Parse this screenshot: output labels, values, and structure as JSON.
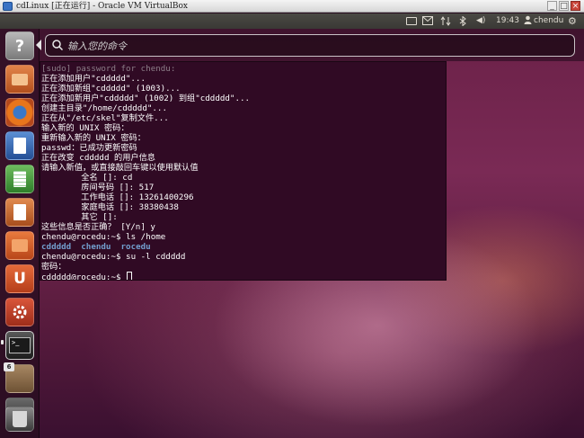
{
  "vbox": {
    "title": "cdLinux [正在运行] - Oracle VM VirtualBox",
    "min_label": "_",
    "restore_label": "□",
    "close_label": "×"
  },
  "panel": {
    "time": "19:43",
    "user": "chendu",
    "volume_glyph": "◀)",
    "settings_glyph": "⚙",
    "user_glyph": "👤"
  },
  "dash": {
    "placeholder": "输入您的命令"
  },
  "launcher": {
    "items": [
      {
        "name": "dash-home",
        "glyph": "?",
        "color": "#9a9a9a"
      },
      {
        "name": "files",
        "glyph": "",
        "color": "#d56a2b"
      },
      {
        "name": "firefox",
        "glyph": "",
        "color": "#d8651b"
      },
      {
        "name": "writer",
        "glyph": "",
        "color": "#2e6fb5"
      },
      {
        "name": "calc",
        "glyph": "",
        "color": "#3c9a35"
      },
      {
        "name": "impress",
        "glyph": "",
        "color": "#c8662a"
      },
      {
        "name": "software-center",
        "glyph": "",
        "color": "#d5602a"
      },
      {
        "name": "ubuntu-one",
        "glyph": "U",
        "color": "#d0532a"
      },
      {
        "name": "settings",
        "glyph": "",
        "color": "#c8432a"
      },
      {
        "name": "terminal",
        "glyph": ">_",
        "color": "#2a2a2a"
      },
      {
        "name": "workspace",
        "glyph": "",
        "color": "#8a6a4a"
      },
      {
        "name": "removable-drive",
        "glyph": "",
        "color": "#3a3a3a"
      },
      {
        "name": "trash",
        "glyph": "",
        "color": "#555555"
      }
    ],
    "workspace_badge": "6"
  },
  "terminal": {
    "lines": [
      {
        "text": "[sudo] password for chendu:",
        "style": "dim"
      },
      {
        "text": "正在添加用户\"cddddd\"..."
      },
      {
        "text": "正在添加新组\"cddddd\" (1003)..."
      },
      {
        "text": "正在添加新用户\"cddddd\" (1002) 到组\"cddddd\"..."
      },
      {
        "text": "创建主目录\"/home/cddddd\"..."
      },
      {
        "text": "正在从\"/etc/skel\"复制文件..."
      },
      {
        "text": "输入新的 UNIX 密码："
      },
      {
        "text": "重新输入新的 UNIX 密码："
      },
      {
        "text": "passwd：已成功更新密码"
      },
      {
        "text": "正在改变 cddddd 的用户信息"
      },
      {
        "text": "请输入新值，或直接敲回车键以使用默认值"
      },
      {
        "text": "        全名 []: cd"
      },
      {
        "text": "        房间号码 []: 517"
      },
      {
        "text": "        工作电话 []: 13261400296"
      },
      {
        "text": "        家庭电话 []: 38380438"
      },
      {
        "text": "        其它 []:"
      },
      {
        "text": "这些信息是否正确？ [Y/n] y"
      },
      {
        "text": "chendu@rocedu:~$ ls /home"
      },
      {
        "text": "cddddd  chendu  rocedu",
        "style": "blue"
      },
      {
        "text": "chendu@rocedu:~$ su -l cddddd"
      },
      {
        "text": "密码："
      },
      {
        "text": "cddddd@rocedu:~$ ",
        "cursor": true
      }
    ]
  }
}
